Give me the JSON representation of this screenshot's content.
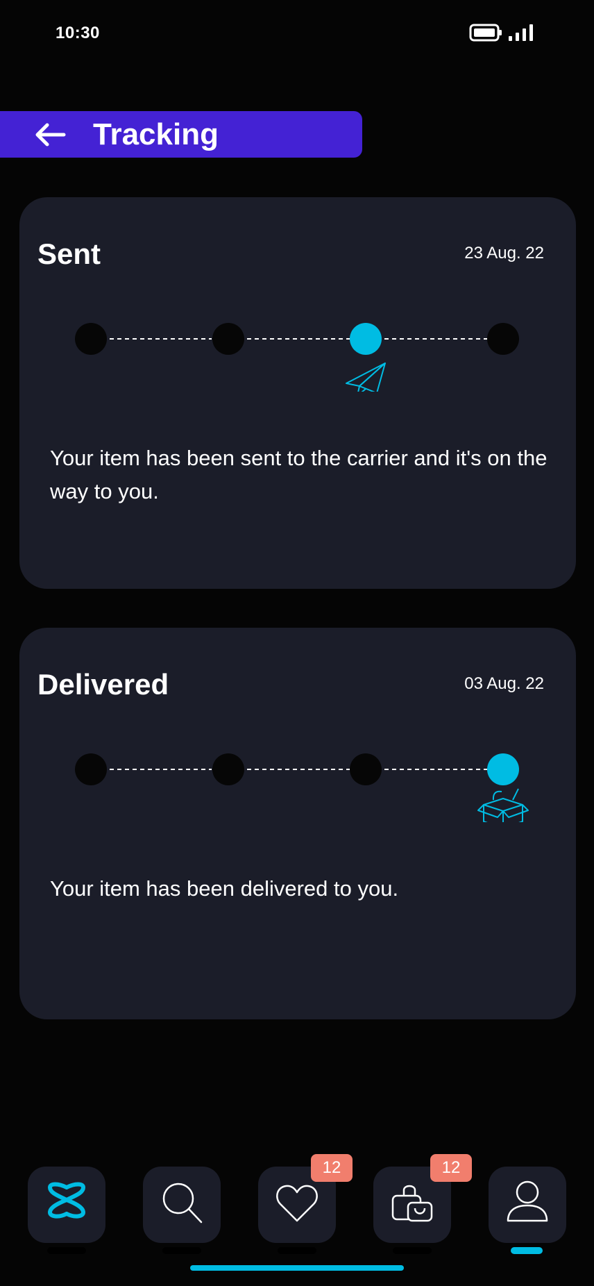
{
  "status_bar": {
    "time": "10:30",
    "battery_icon": "battery-icon",
    "signal_icon": "signal-icon"
  },
  "header": {
    "title": "Tracking",
    "back_icon": "arrow-left-icon",
    "color": "#4422D4"
  },
  "colors": {
    "accent": "#00BCE3",
    "card": "#1B1D29",
    "background": "#050505",
    "badge": "#F17E6D"
  },
  "tracking": [
    {
      "status": "Sent",
      "date": "23 Aug. 22",
      "active_step": 3,
      "total_steps": 4,
      "step_icon": "paper-plane-icon",
      "description": "Your item has been sent to the carrier and it's on the way to you."
    },
    {
      "status": "Delivered",
      "date": "03 Aug. 22",
      "active_step": 4,
      "total_steps": 4,
      "step_icon": "open-box-icon",
      "description": "Your item has been delivered to you."
    }
  ],
  "bottom_nav": {
    "items": [
      {
        "name": "home",
        "icon": "logo-icon",
        "active": false
      },
      {
        "name": "search",
        "icon": "search-icon",
        "active": false
      },
      {
        "name": "favorites",
        "icon": "heart-icon",
        "active": false,
        "badge": "12"
      },
      {
        "name": "bag",
        "icon": "shopping-bag-icon",
        "active": false,
        "badge": "12"
      },
      {
        "name": "profile",
        "icon": "user-icon",
        "active": true
      }
    ]
  }
}
